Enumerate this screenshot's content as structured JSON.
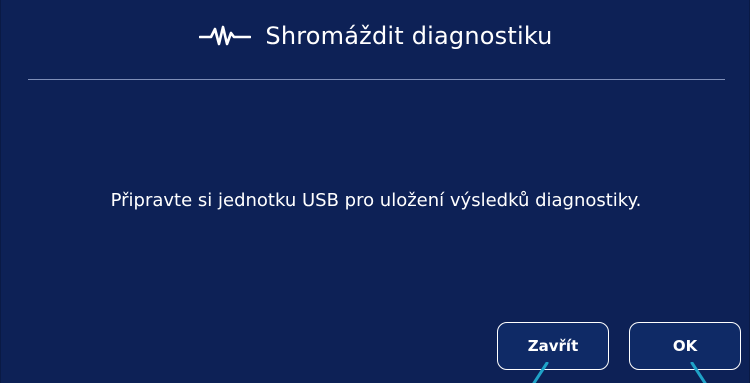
{
  "dialog": {
    "title": "Shromáždit diagnostiku",
    "title_icon": "pulse-icon",
    "message": "Připravte si jednotku USB pro uložení výsledků diagnostiky.",
    "buttons": {
      "close_label": "Zavřít",
      "ok_label": "OK"
    }
  },
  "colors": {
    "background": "#0d2156",
    "text": "#ffffff",
    "divider": "#7f8fb8",
    "accent": "#1fa3c8"
  }
}
